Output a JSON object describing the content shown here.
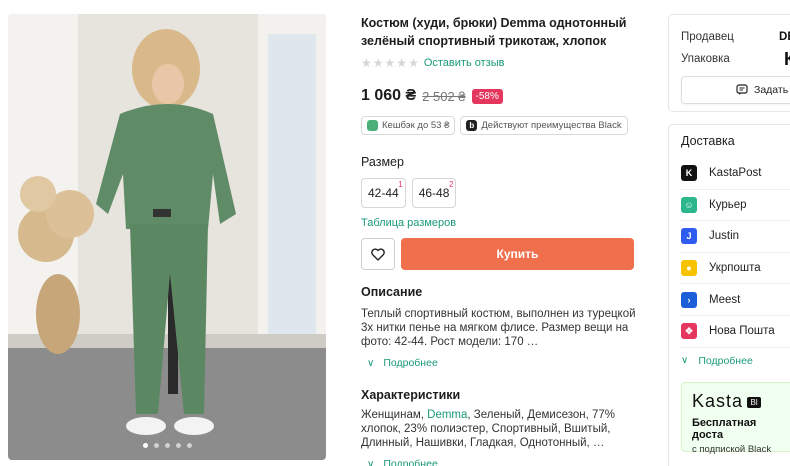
{
  "product": {
    "title": "Костюм (худи, брюки) Demma однотонный зелёный спортивный трикотаж, хлопок",
    "review_link": "Оставить отзыв",
    "price_current": "1 060 ₴",
    "price_old": "2 502 ₴",
    "discount": "-58%",
    "cashback": "Кешбэк до 53 ₴",
    "black_benefits": "Действуют преимущества Black",
    "size_heading": "Размер",
    "sizes": [
      {
        "label": "42-44",
        "count": "1"
      },
      {
        "label": "46-48",
        "count": "2"
      }
    ],
    "size_table_link": "Таблица размеров",
    "buy_label": "Купить",
    "description_heading": "Описание",
    "description": "Теплый спортивный костюм, выполнен из турецкой 3х нитки пенье на мягком флисе. Размер вещи на фото: 42-44. Рост модели: 170 …",
    "more_label": "Подробнее",
    "characteristics_heading": "Характеристики",
    "characteristics_prefix": "Женщинам, ",
    "characteristics_brand": "Demma",
    "characteristics_rest": ", Зеленый, Демисезон, 77% хлопок, 23% полиэстер, Спортивный, Вшитый, Длинный, Нашивки, Гладкая, Однотонный, …",
    "more_label_2": "Подробнее"
  },
  "panel": {
    "seller_label": "Продавец",
    "seller_value": "DE",
    "packaging_label": "Упаковка",
    "packaging_value": "К",
    "write_button": "Задать",
    "delivery_heading": "Доставка",
    "delivery_items": [
      {
        "label": "KastaPost",
        "icon": "kastapost-icon",
        "color": "#111111",
        "glyph": "K"
      },
      {
        "label": "Курьер",
        "icon": "courier-icon",
        "color": "#2bb68b",
        "glyph": "☺"
      },
      {
        "label": "Justin",
        "icon": "justin-icon",
        "color": "#2f5cf0",
        "glyph": "J"
      },
      {
        "label": "Укрпошта",
        "icon": "ukrposhta-icon",
        "color": "#f7c300",
        "glyph": "●"
      },
      {
        "label": "Meest",
        "icon": "meest-icon",
        "color": "#1a5fd8",
        "glyph": "›"
      },
      {
        "label": "Нова Пошта",
        "icon": "novaposhta-icon",
        "color": "#e5375e",
        "glyph": "✥"
      }
    ],
    "delivery_more": "Подробнее",
    "promo_logo": "Kasta",
    "promo_badge": "Bl",
    "promo_title": "Бесплатная доста",
    "promo_sub": "с подпиской Black"
  },
  "colors": {
    "accent_green": "#1a9a78",
    "buy_orange": "#f06f4d",
    "discount_pink": "#e5375e"
  }
}
